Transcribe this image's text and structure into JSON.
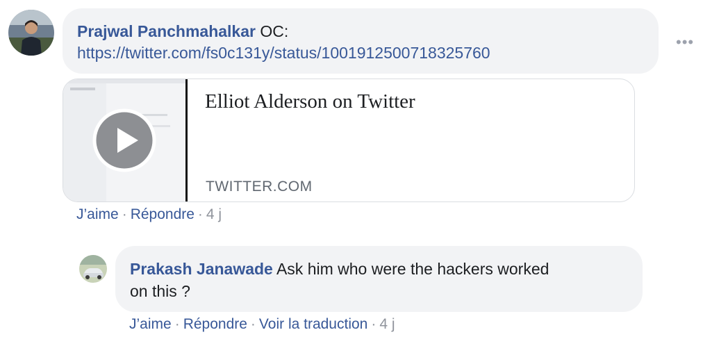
{
  "comment": {
    "author": "Prajwal Panchmahalkar",
    "text_prefix": "OC:",
    "link": "https://twitter.com/fs0c131y/status/1001912500718325760",
    "more_icon": "ellipsis-icon",
    "preview": {
      "title": "Elliot Alderson on Twitter",
      "domain": "TWITTER.COM",
      "play_icon": "play-icon"
    },
    "actions": {
      "like": "J’aime",
      "sep1": "·",
      "reply": "Répondre",
      "sep2": "·",
      "time": "4 j"
    }
  },
  "reply": {
    "author": "Prakash Janawade",
    "text_line1": "Ask him who were the hackers worked",
    "text_line2": "on this ?",
    "actions": {
      "like": "J’aime",
      "sep1": "·",
      "reply": "Répondre",
      "sep2": "·",
      "translate": "Voir la traduction",
      "sep3": "·",
      "time": "4 j"
    }
  },
  "colors": {
    "author": "#385898",
    "bubble": "#f2f3f5",
    "meta": "#90949c"
  }
}
